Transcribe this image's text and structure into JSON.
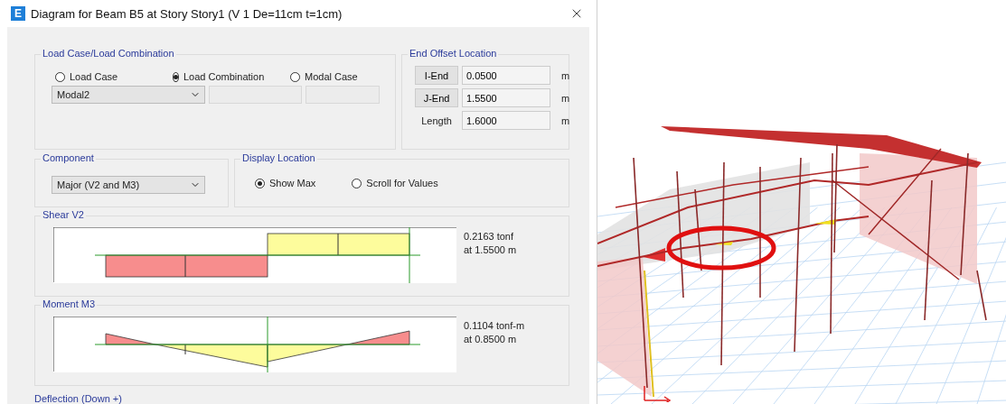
{
  "window": {
    "app_icon": "E",
    "title": "Diagram for Beam B5 at Story Story1 (V 1 De=11cm t=1cm)"
  },
  "load_case": {
    "title": "Load Case/Load Combination",
    "radios": [
      {
        "label": "Load Case",
        "selected": false
      },
      {
        "label": "Load Combination",
        "selected": true
      },
      {
        "label": "Modal Case",
        "selected": false
      }
    ],
    "dropdown": "Modal2"
  },
  "end_offset": {
    "title": "End Offset Location",
    "rows": [
      {
        "kind": "button",
        "label": "I-End",
        "value": "0.0500",
        "unit": "m"
      },
      {
        "kind": "button",
        "label": "J-End",
        "value": "1.5500",
        "unit": "m"
      },
      {
        "kind": "label",
        "label": "Length",
        "value": "1.6000",
        "unit": "m"
      }
    ]
  },
  "component": {
    "title": "Component",
    "dropdown": "Major (V2 and M3)"
  },
  "display_location": {
    "title": "Display Location",
    "radios": [
      {
        "label": "Show Max",
        "selected": true
      },
      {
        "label": "Scroll for Values",
        "selected": false
      }
    ]
  },
  "diagrams": [
    {
      "kind": "shear",
      "title": "Shear V2",
      "readings": [
        "0.2163 tonf",
        "at 1.5500 m"
      ]
    },
    {
      "kind": "moment",
      "title": "Moment M3",
      "readings": [
        "0.1104 tonf-m",
        "at 0.8500 m"
      ]
    },
    {
      "kind": "cut",
      "title": "Deflection (Down +)"
    }
  ]
}
